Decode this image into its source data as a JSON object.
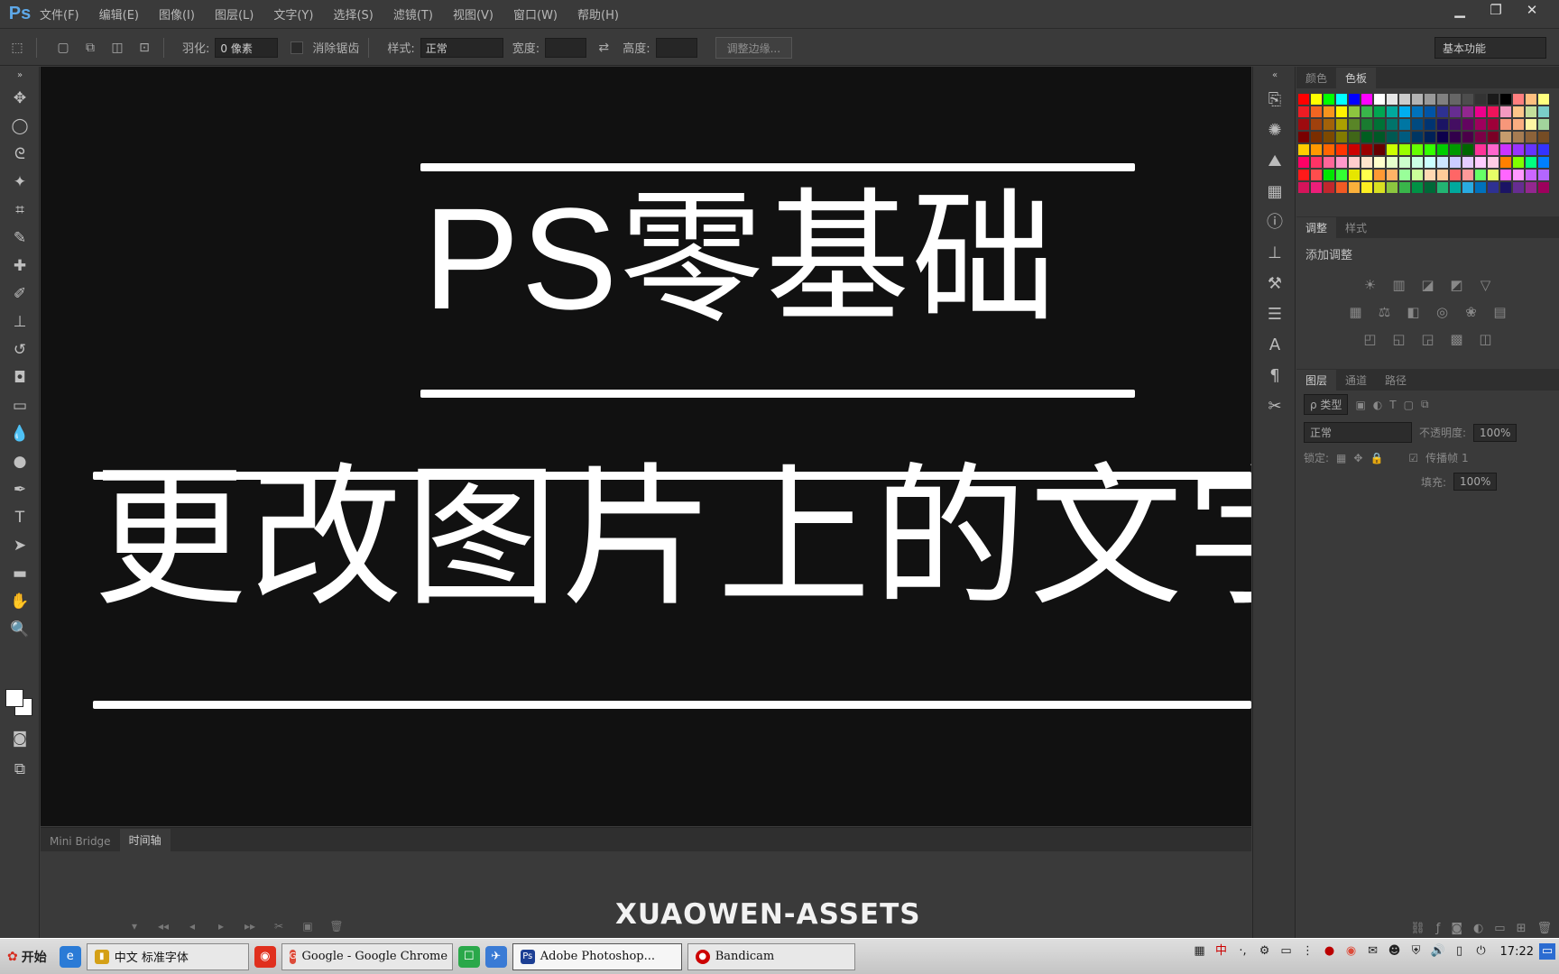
{
  "app": {
    "logo": "Ps"
  },
  "menu": [
    "文件(F)",
    "编辑(E)",
    "图像(I)",
    "图层(L)",
    "文字(Y)",
    "选择(S)",
    "滤镜(T)",
    "视图(V)",
    "窗口(W)",
    "帮助(H)"
  ],
  "window_controls": {
    "minimize": "▁",
    "restore": "❐",
    "close": "✕"
  },
  "options_bar": {
    "feather_label": "羽化:",
    "feather_value": "0 像素",
    "antialias_label": "消除锯齿",
    "style_label": "样式:",
    "style_value": "正常",
    "width_label": "宽度:",
    "height_label": "高度:",
    "refine_edge_button": "调整边缘...",
    "workspace": "基本功能"
  },
  "canvas": {
    "title_main": "PS零基础",
    "title_sub": "更改图片上的文字"
  },
  "timeline": {
    "tabs": [
      "Mini Bridge",
      "时间轴"
    ],
    "controls": [
      "▾",
      "◂◂",
      "◂",
      "▸",
      "▸▸",
      "✂",
      "▣",
      "🗑"
    ]
  },
  "watermark": "XUAOWEN-ASSETS",
  "panels": {
    "color_tabs": [
      "颜色",
      "色板"
    ],
    "adjust_tabs": [
      "调整",
      "样式"
    ],
    "adjust_title": "添加调整",
    "layers_tabs": [
      "图层",
      "通道",
      "路径"
    ],
    "layer_kind": "ρ 类型",
    "blend_mode": "正常",
    "opacity_label": "不透明度:",
    "opacity_value": "100%",
    "lock_label": "锁定:",
    "fill_label": "填充:",
    "fill_value": "100%",
    "propagate_label": "传播帧 1"
  },
  "swatch_colors": [
    "#ff0000",
    "#ffff00",
    "#00ff00",
    "#00ffff",
    "#0000ff",
    "#ff00ff",
    "#ffffff",
    "#e6e6e6",
    "#cccccc",
    "#b3b3b3",
    "#999999",
    "#808080",
    "#666666",
    "#4d4d4d",
    "#333333",
    "#1a1a1a",
    "#000000",
    "#ff7f7f",
    "#ffbf7f",
    "#ffff7f",
    "#ed1c24",
    "#f26522",
    "#f7941d",
    "#fff200",
    "#8dc63f",
    "#39b54a",
    "#00a651",
    "#00a99d",
    "#00aeef",
    "#0072bc",
    "#0054a6",
    "#2e3192",
    "#662d91",
    "#92278f",
    "#ec008c",
    "#ed145b",
    "#f49ac1",
    "#fdc689",
    "#c4df9b",
    "#7accc8",
    "#9e0b0f",
    "#a0410d",
    "#a36209",
    "#aba000",
    "#598527",
    "#197b30",
    "#007236",
    "#00746b",
    "#0076a3",
    "#004a80",
    "#003471",
    "#1b1464",
    "#440e62",
    "#630460",
    "#9e005d",
    "#9e0039",
    "#f7977a",
    "#f9ad81",
    "#fdf6a4",
    "#a2d39c",
    "#790000",
    "#7b2e00",
    "#7d4900",
    "#827b00",
    "#406618",
    "#005e20",
    "#005826",
    "#005952",
    "#005b7f",
    "#003663",
    "#002157",
    "#0d004c",
    "#32004b",
    "#4b0049",
    "#7b0046",
    "#7a0026",
    "#c69c6d",
    "#a67c52",
    "#8c6239",
    "#754c24",
    "#ffcc00",
    "#ff9900",
    "#ff6600",
    "#ff3300",
    "#cc0000",
    "#990000",
    "#660000",
    "#ccff00",
    "#99ff00",
    "#66ff00",
    "#33ff00",
    "#00cc00",
    "#009900",
    "#006600",
    "#ff3399",
    "#ff66cc",
    "#cc33ff",
    "#9933ff",
    "#6633ff",
    "#3333ff",
    "#ff0066",
    "#ff3366",
    "#ff6699",
    "#ff99cc",
    "#ffcccc",
    "#ffe5cc",
    "#ffffcc",
    "#e5ffcc",
    "#ccffcc",
    "#ccffe5",
    "#ccffff",
    "#cce5ff",
    "#ccccff",
    "#e5ccff",
    "#ffccff",
    "#ffcce5",
    "#ff8000",
    "#80ff00",
    "#00ff80",
    "#0080ff",
    "#ff1a1a",
    "#ff4d4d",
    "#00e600",
    "#33ff33",
    "#e6e600",
    "#ffff4d",
    "#ff9933",
    "#ffb366",
    "#99ff99",
    "#ccff99",
    "#ffd9b3",
    "#ffcc99",
    "#ff6666",
    "#ff9999",
    "#66ff66",
    "#e6ff66",
    "#ff66ff",
    "#ff99ff",
    "#cc66ff",
    "#b366ff",
    "#d4145a",
    "#ed1e79",
    "#c1272d",
    "#f15a24",
    "#fbb03b",
    "#fcee21",
    "#d9e021",
    "#8cc63f",
    "#39b54a",
    "#009245",
    "#006837",
    "#22b573",
    "#00a99d",
    "#29abe2",
    "#0071bc",
    "#2e3192",
    "#1b1464",
    "#662d91",
    "#93278f",
    "#9e005d"
  ],
  "adjust_icons": [
    [
      "☀",
      "▥",
      "◪",
      "◩",
      "▽"
    ],
    [
      "▦",
      "⚖",
      "◧",
      "◎",
      "❀",
      "▤"
    ],
    [
      "◰",
      "◱",
      "◲",
      "▩",
      "◫"
    ]
  ],
  "taskbar": {
    "start": "开始",
    "items": [
      {
        "label": "中文 标准字体",
        "color": "#d4a017",
        "glyph": "中"
      },
      {
        "label": "Google - Google Chrome",
        "color": "#dd4b39",
        "glyph": "G"
      },
      {
        "label": "Adobe Photoshop...",
        "color": "#1c3f94",
        "glyph": "Ps"
      },
      {
        "label": "Bandicam",
        "color": "#cc0000",
        "glyph": "●"
      }
    ],
    "clock": "17:22"
  }
}
